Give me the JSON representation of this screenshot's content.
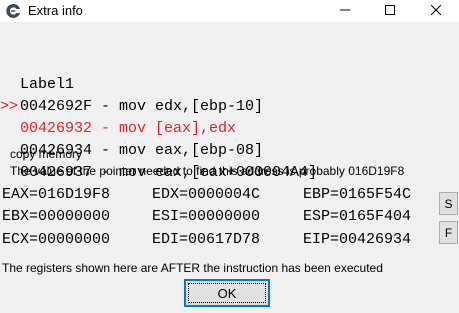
{
  "window": {
    "title": "Extra info",
    "icons": {
      "app": "cheat-engine-icon",
      "minimize": "minimize-icon",
      "maximize": "maximize-icon",
      "close": "close-icon"
    }
  },
  "disassembly": [
    {
      "marker": "",
      "text": "Label1",
      "current": false
    },
    {
      "marker": "",
      "text": "0042692F - mov edx,[ebp-10]",
      "current": false
    },
    {
      "marker": ">>",
      "text": "00426932 - mov [eax],edx",
      "current": true
    },
    {
      "marker": "",
      "text": "00426934 - mov eax,[ebp-08]",
      "current": false
    },
    {
      "marker": "",
      "text": "00426937 - mov eax,[eax+000004A4]",
      "current": false
    }
  ],
  "copy_memory_label": "copy memory",
  "pointer_info": "The value of the pointer needed to find this address is probably 016D19F8",
  "registers": [
    [
      "EAX=016D19F8",
      "EDX=0000004C",
      "EBP=0165F54C"
    ],
    [
      "EBX=00000000",
      "ESI=00000000",
      "ESP=0165F404"
    ],
    [
      "ECX=00000000",
      "EDI=00617D78",
      "EIP=00426934"
    ]
  ],
  "side_buttons": {
    "s": "S",
    "f": "F"
  },
  "footer_note": "The registers shown here are AFTER the instruction has been executed",
  "ok_label": "OK",
  "colors": {
    "current_line": "#e0202a",
    "focus_border": "#0078d7"
  }
}
